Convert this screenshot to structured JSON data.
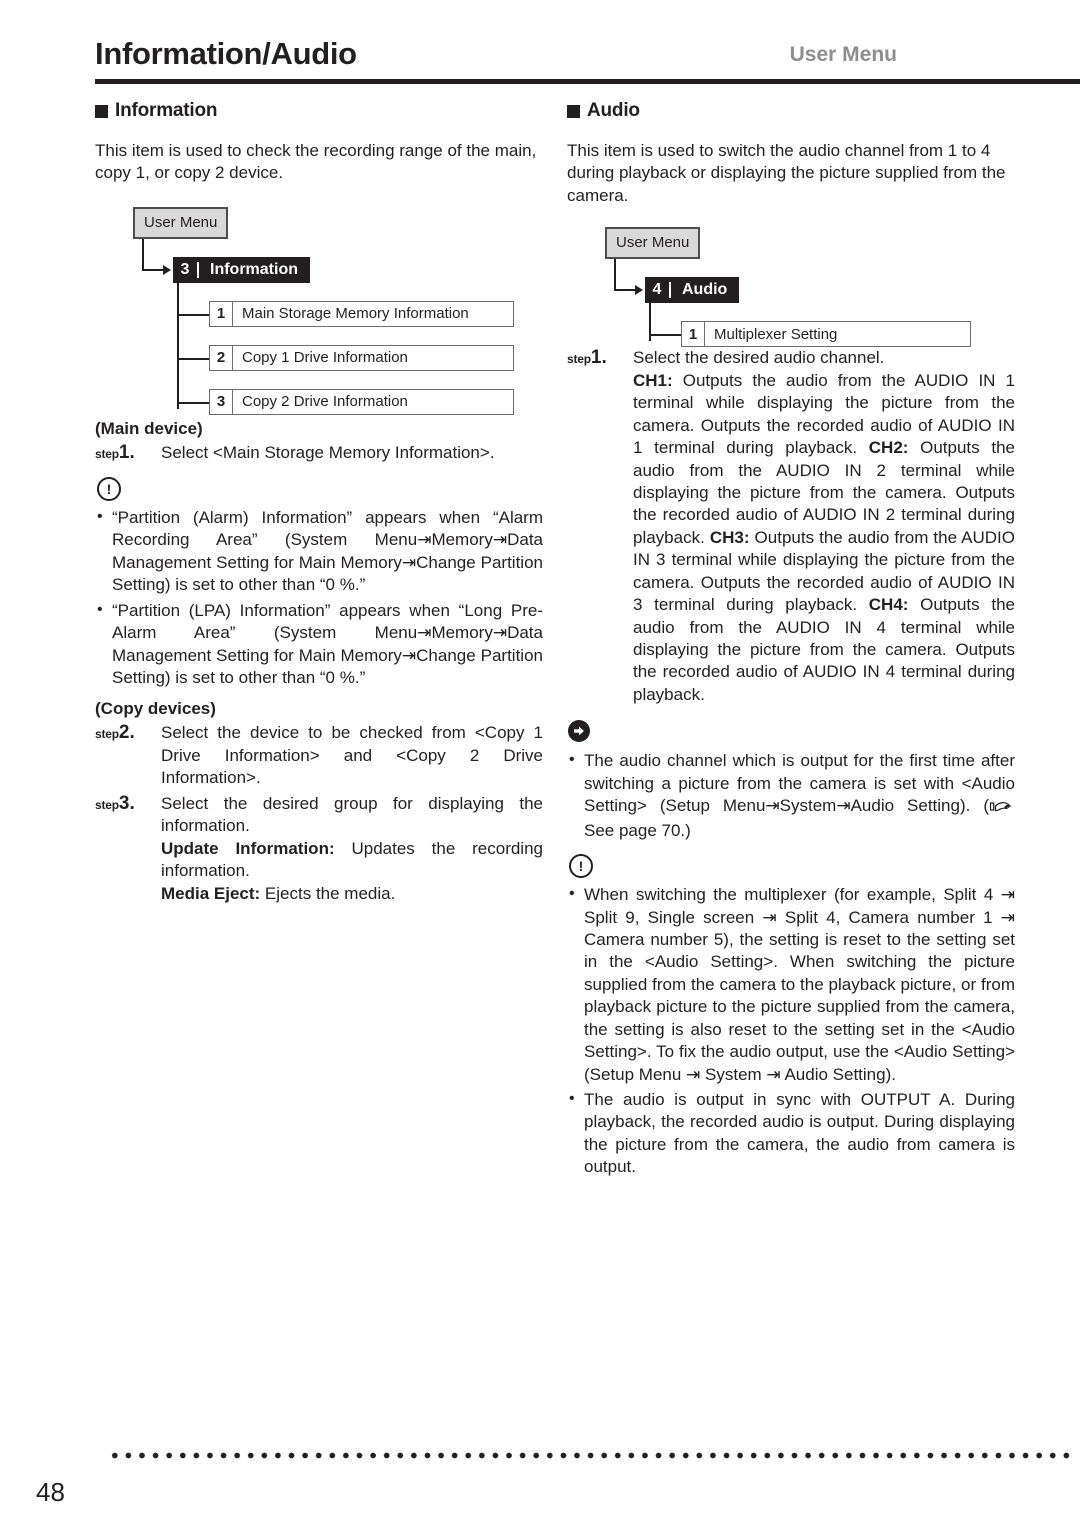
{
  "header": {
    "title": "Information/Audio",
    "right_label": "User Menu"
  },
  "left_column": {
    "section_title": "Information",
    "intro": "This item is used to check the recording range of the main, copy 1, or copy 2 device.",
    "diagram": {
      "root_label": "User Menu",
      "parent_number": "3",
      "parent_label": "Information",
      "children": [
        {
          "number": "1",
          "label": "Main Storage Memory Information"
        },
        {
          "number": "2",
          "label": "Copy 1 Drive Information"
        },
        {
          "number": "3",
          "label": "Copy 2 Drive Information"
        }
      ]
    },
    "main_device": {
      "heading": "(Main device)",
      "step_prefix": "step",
      "step_number": "1.",
      "step_text": "Select <Main Storage Memory Information>."
    },
    "caution_icon": "!",
    "notes": [
      "“Partition (Alarm) Information” appears when “Alarm Recording Area” (System Menu⇥Memory⇥Data Management Setting for Main Memory⇥Change Partition Setting) is set to other than “0 %.”",
      "“Partition (LPA) Information” appears when “Long Pre-Alarm Area” (System Menu⇥Memory⇥Data Management Setting for Main Memory⇥Change Partition Setting) is set to other than “0 %.”"
    ],
    "copy_devices": {
      "heading": "(Copy devices)",
      "step_prefix": "step",
      "steps": [
        {
          "number": "2.",
          "text": "Select the device to be checked from <Copy 1 Drive Information> and <Copy 2 Drive Information>."
        },
        {
          "number": "3.",
          "text": "Select the desired group for displaying the information.",
          "detail_label_1": "Update Information:",
          "detail_text_1": " Updates the recording information.",
          "detail_label_2": "Media Eject:",
          "detail_text_2": " Ejects the media."
        }
      ]
    }
  },
  "right_column": {
    "section_title": "Audio",
    "intro": "This item is used to switch the audio channel from 1 to 4 during playback or displaying the picture supplied from the camera.",
    "diagram": {
      "root_label": "User Menu",
      "parent_number": "4",
      "parent_label": "Audio",
      "children": [
        {
          "number": "1",
          "label": "Multiplexer Setting"
        }
      ]
    },
    "step": {
      "step_prefix": "step",
      "step_number": "1.",
      "step_text": "Select the desired audio channel.",
      "channels": [
        {
          "label": "CH1:",
          "text": " Outputs the audio from the AUDIO IN 1 terminal while displaying the picture from the camera. Outputs the recorded audio of AUDIO IN 1 terminal during playback."
        },
        {
          "label": "CH2:",
          "text": " Outputs the audio from the AUDIO IN 2 terminal while displaying the picture from the camera. Outputs the recorded audio of AUDIO IN 2 terminal during playback."
        },
        {
          "label": "CH3:",
          "text": " Outputs the audio from the AUDIO IN 3 terminal while displaying the picture from the camera. Outputs the recorded audio of AUDIO IN 3 terminal during playback."
        },
        {
          "label": "CH4:",
          "text": " Outputs the audio from the AUDIO IN 4 terminal while displaying the picture from the camera. Outputs the recorded audio of AUDIO IN 4 terminal during playback."
        }
      ]
    },
    "tip_note": {
      "part1": "The audio channel which is output for the first time after switching a picture from the camera is set with <Audio Setting> (Setup Menu⇥System⇥Audio Setting). (",
      "part2": " See page 70.)"
    },
    "caution_icon": "!",
    "caution_notes": [
      "When switching the multiplexer (for example, Split 4 ⇥ Split 9, Single screen ⇥ Split 4, Camera number 1 ⇥ Camera number 5), the setting is reset to the setting set in the <Audio Setting>. When switching the picture supplied from the camera to the playback picture, or from playback picture to the picture supplied from the camera, the setting is also reset to the setting set in the <Audio Setting>. To fix the audio output, use the <Audio Setting> (Setup Menu ⇥ System ⇥ Audio Setting).",
      "The audio is output in sync with OUTPUT A. During playback, the recorded audio is output. During displaying the picture from the camera, the audio from camera is output."
    ]
  },
  "footer": {
    "page_number": "48"
  }
}
